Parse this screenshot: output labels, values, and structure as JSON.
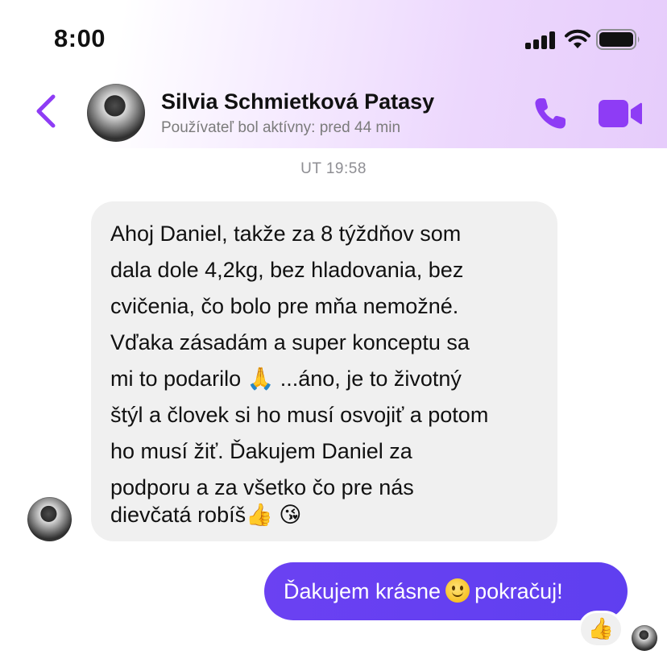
{
  "status_bar": {
    "time": "8:00"
  },
  "header": {
    "contact_name": "Silvia Schmietková Patasy",
    "contact_status": "Používateľ bol aktívny: pred 44 min"
  },
  "conversation": {
    "timestamp": "UT 19:58",
    "incoming": {
      "lines": [
        "Ahoj Daniel, takže za 8 týždňov som",
        "dala dole 4,2kg, bez hladovania, bez",
        "cvičenia, čo bolo pre mňa nemožné.",
        "Vďaka zásadám a super konceptu sa",
        "mi to podarilo",
        "...áno, je to životný",
        "štýl a človek si ho musí osvojiť a potom",
        "ho musí žiť. Ďakujem Daniel za",
        "podporu a za všetko čo pre nás",
        "dievčatá robíš"
      ],
      "emoji_pray": "🙏",
      "emoji_thumbs": "👍",
      "emoji_kiss": "😘"
    },
    "outgoing": {
      "text_before": "Ďakujem krásne",
      "text_after": "pokračuj!"
    },
    "reaction": "👍"
  },
  "colors": {
    "accent": "#8e3cf5",
    "outgoing_bubble": "#6a3df5",
    "incoming_bubble": "#f0f0f0"
  },
  "icons": [
    "back-chevron-icon",
    "phone-icon",
    "video-camera-icon",
    "signal-icon",
    "wifi-icon",
    "battery-icon"
  ]
}
